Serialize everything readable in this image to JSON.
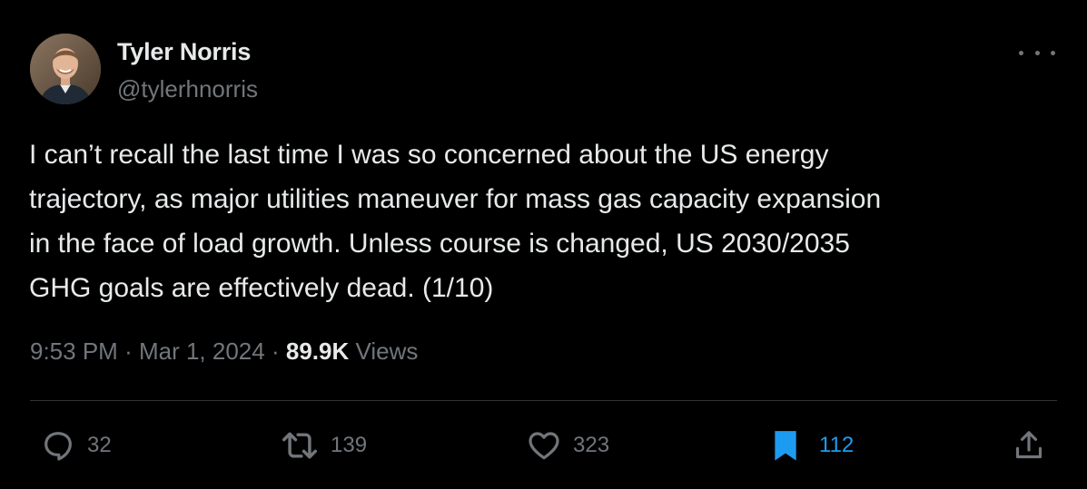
{
  "author": {
    "display_name": "Tyler Norris",
    "handle": "@tylerhnorris"
  },
  "tweet": {
    "text": "I can’t recall the last time I was so concerned about the US energy\ntrajectory, as major utilities maneuver for mass gas capacity expansion\nin the face of load growth. Unless course is changed, US 2030/2035\nGHG goals are effectively dead. (1/10)",
    "time": "9:53 PM",
    "separator": "·",
    "date": "Mar 1, 2024",
    "views_count": "89.9K",
    "views_label": "Views"
  },
  "actions": {
    "replies": "32",
    "reposts": "139",
    "likes": "323",
    "bookmarks": "112"
  },
  "icons": {
    "more": "more-horizontal-icon",
    "reply": "reply-bubble-icon",
    "repost": "repost-icon",
    "like": "heart-icon",
    "bookmark": "bookmark-icon",
    "share": "share-icon"
  },
  "colors": {
    "background": "#000000",
    "text_primary": "#e7e9ea",
    "text_secondary": "#71767b",
    "accent": "#1d9bf0",
    "divider": "#2f3336"
  }
}
